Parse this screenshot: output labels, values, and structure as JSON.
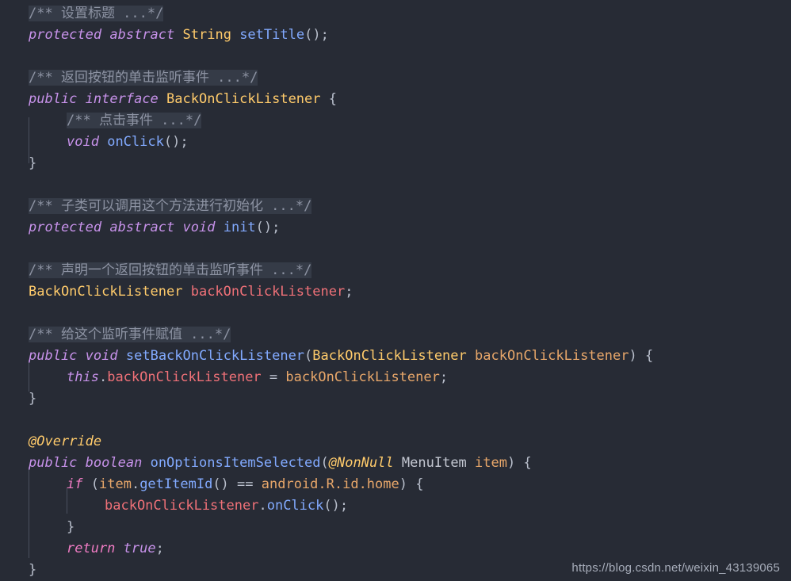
{
  "editor": {
    "background_color": "#272b35",
    "default_text_color": "#c3c7d1",
    "comment_background_color": "#353b47",
    "comment_text_color": "#8d93a3",
    "language": "Java",
    "lines": [
      {
        "indent": 0,
        "type": "comment",
        "text": "/** 设置标题 ...*/"
      },
      {
        "indent": 0,
        "type": "code",
        "text": "protected abstract String setTitle();"
      },
      {
        "indent": 0,
        "type": "blank",
        "text": ""
      },
      {
        "indent": 0,
        "type": "comment",
        "text": "/** 返回按钮的单击监听事件 ...*/"
      },
      {
        "indent": 0,
        "type": "code",
        "text": "public interface BackOnClickListener {"
      },
      {
        "indent": 1,
        "type": "comment",
        "text": "/** 点击事件 ...*/"
      },
      {
        "indent": 1,
        "type": "code",
        "text": "void onClick();"
      },
      {
        "indent": 0,
        "type": "code",
        "text": "}"
      },
      {
        "indent": 0,
        "type": "blank",
        "text": ""
      },
      {
        "indent": 0,
        "type": "comment",
        "text": "/** 子类可以调用这个方法进行初始化 ...*/"
      },
      {
        "indent": 0,
        "type": "code",
        "text": "protected abstract void init();"
      },
      {
        "indent": 0,
        "type": "blank",
        "text": ""
      },
      {
        "indent": 0,
        "type": "comment",
        "text": "/** 声明一个返回按钮的单击监听事件 ...*/"
      },
      {
        "indent": 0,
        "type": "code",
        "text": "BackOnClickListener backOnClickListener;"
      },
      {
        "indent": 0,
        "type": "blank",
        "text": ""
      },
      {
        "indent": 0,
        "type": "comment",
        "text": "/** 给这个监听事件赋值 ...*/"
      },
      {
        "indent": 0,
        "type": "code",
        "text": "public void setBackOnClickListener(BackOnClickListener backOnClickListener) {"
      },
      {
        "indent": 1,
        "type": "code",
        "text": "this.backOnClickListener = backOnClickListener;"
      },
      {
        "indent": 0,
        "type": "code",
        "text": "}"
      },
      {
        "indent": 0,
        "type": "blank",
        "text": ""
      },
      {
        "indent": 0,
        "type": "code",
        "text": "@Override"
      },
      {
        "indent": 0,
        "type": "code",
        "text": "public boolean onOptionsItemSelected(@NonNull MenuItem item) {"
      },
      {
        "indent": 1,
        "type": "code",
        "text": "if (item.getItemId() == android.R.id.home) {"
      },
      {
        "indent": 2,
        "type": "code",
        "text": "backOnClickListener.onClick();"
      },
      {
        "indent": 1,
        "type": "code",
        "text": "}"
      },
      {
        "indent": 1,
        "type": "code",
        "text": "return true;"
      },
      {
        "indent": 0,
        "type": "code",
        "text": "}"
      }
    ],
    "tokens": {
      "comment_1": "/** 设置标题 ...*/",
      "comment_2": "/** 返回按钮的单击监听事件 ...*/",
      "comment_3": "/** 点击事件 ...*/",
      "comment_4": "/** 子类可以调用这个方法进行初始化 ...*/",
      "comment_5": "/** 声明一个返回按钮的单击监听事件 ...*/",
      "comment_6": "/** 给这个监听事件赋值 ...*/",
      "kw_protected": "protected",
      "kw_abstract": "abstract",
      "kw_public": "public",
      "kw_interface": "interface",
      "kw_void": "void",
      "kw_boolean": "boolean",
      "kw_this": "this",
      "kw_if": "if",
      "kw_return": "return",
      "kw_true": "true",
      "type_String": "String",
      "type_BackOnClickListener": "BackOnClickListener",
      "type_MenuItem": "MenuItem",
      "method_setTitle": "setTitle",
      "method_onClick": "onClick",
      "method_init": "init",
      "method_setBackOnClickListener": "setBackOnClickListener",
      "method_onOptionsItemSelected": "onOptionsItemSelected",
      "method_getItemId": "getItemId",
      "field_backOnClickListener": "backOnClickListener",
      "param_backOnClickListener": "backOnClickListener",
      "param_item": "item",
      "anno_Override": "@Override",
      "anno_NonNull": "@NonNull",
      "const_android_home": "android.R.id.home",
      "op_assign": " = ",
      "op_equals": " == ",
      "p_semi": ";",
      "p_parens": "()",
      "p_open_brace": " {",
      "p_close_brace": "}",
      "p_dot": ".",
      "p_space": " ",
      "p_lparen": "(",
      "p_rparen": ")",
      "p_rparen_brace": ") {"
    }
  },
  "watermark": {
    "text": "https://blog.csdn.net/weixin_43139065"
  }
}
